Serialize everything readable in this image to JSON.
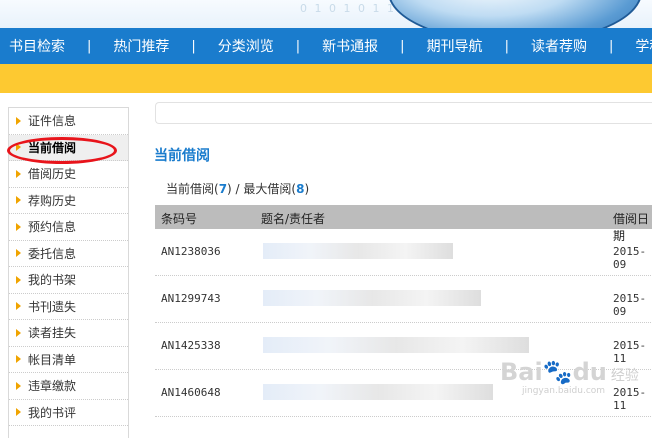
{
  "nav": {
    "items": [
      "书目检索",
      "热门推荐",
      "分类浏览",
      "新书通报",
      "期刊导航",
      "读者荐购",
      "学科参"
    ],
    "separator": "|"
  },
  "sidebar": {
    "items": [
      "证件信息",
      "当前借阅",
      "借阅历史",
      "荐购历史",
      "预约信息",
      "委托信息",
      "我的书架",
      "书刊遗失",
      "读者挂失",
      "帐目清单",
      "违章缴款",
      "我的书评"
    ],
    "active": "当前借阅"
  },
  "main": {
    "section_title": "当前借阅",
    "summary": {
      "current_label": "当前借阅(",
      "current_count": "7",
      "sep": ") / 最大借阅(",
      "max_count": "8",
      "close": ")"
    },
    "table": {
      "headers": [
        "条码号",
        "题名/责任者",
        "借阅日期"
      ],
      "rows": [
        {
          "barcode": "AN1238036",
          "date": "2015-09"
        },
        {
          "barcode": "AN1299743",
          "date": "2015-09"
        },
        {
          "barcode": "AN1425338",
          "date": "2015-11"
        },
        {
          "barcode": "AN1460648",
          "date": "2015-11"
        }
      ]
    }
  },
  "watermark": {
    "brand": "Bai",
    "brand2": "du",
    "cn": "经验",
    "url": "jingyan.baidu.com"
  },
  "banner_digits": "0 1 0 1 0 1 1",
  "colors": {
    "nav_bg": "#1a7ccd",
    "yellow_bar": "#fdc931",
    "highlight_ring": "#e8141b",
    "accent_text": "#1a7ccd"
  }
}
